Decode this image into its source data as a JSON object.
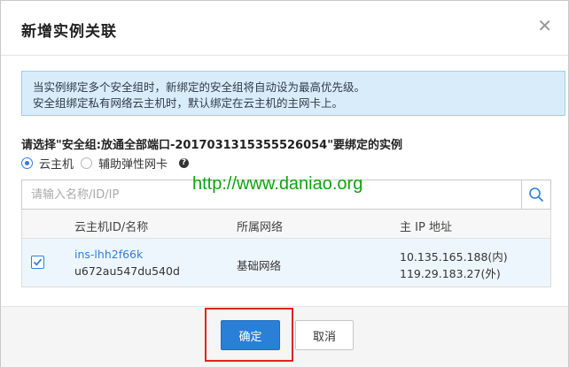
{
  "dialog": {
    "title": "新增实例关联",
    "close_icon": "close-icon"
  },
  "notice": {
    "line1": "当实例绑定多个安全组时，新绑定的安全组将自动设为最高优先级。",
    "line2": "安全组绑定私有网络云主机时，默认绑定在云主机的主网卡上。"
  },
  "security_group": {
    "prompt": "请选择\"安全组:放通全部端口-2017031315355526054\"要绑定的实例"
  },
  "instance_type": {
    "options": [
      {
        "label": "云主机",
        "selected": true
      },
      {
        "label": "辅助弹性网卡",
        "selected": false
      }
    ],
    "help_icon": "question-icon"
  },
  "search": {
    "placeholder": "请输入名称/ID/IP",
    "value": "",
    "icon": "search-icon"
  },
  "watermark": "http://www.daniao.org",
  "table": {
    "columns": [
      "云主机ID/名称",
      "所属网络",
      "主 IP 地址"
    ],
    "rows": [
      {
        "checked": true,
        "id": "ins-lhh2f66k",
        "name": "u672au547du540d",
        "network": "基础网络",
        "ip_private": "10.135.165.188(内)",
        "ip_public": "119.29.183.27(外)"
      }
    ]
  },
  "footer": {
    "ok_label": "确定",
    "cancel_label": "取消"
  },
  "colors": {
    "accent": "#2a7fd6",
    "notice_bg": "#d9ecfa",
    "highlight": "#e0241a",
    "watermark": "#0fa30f"
  }
}
